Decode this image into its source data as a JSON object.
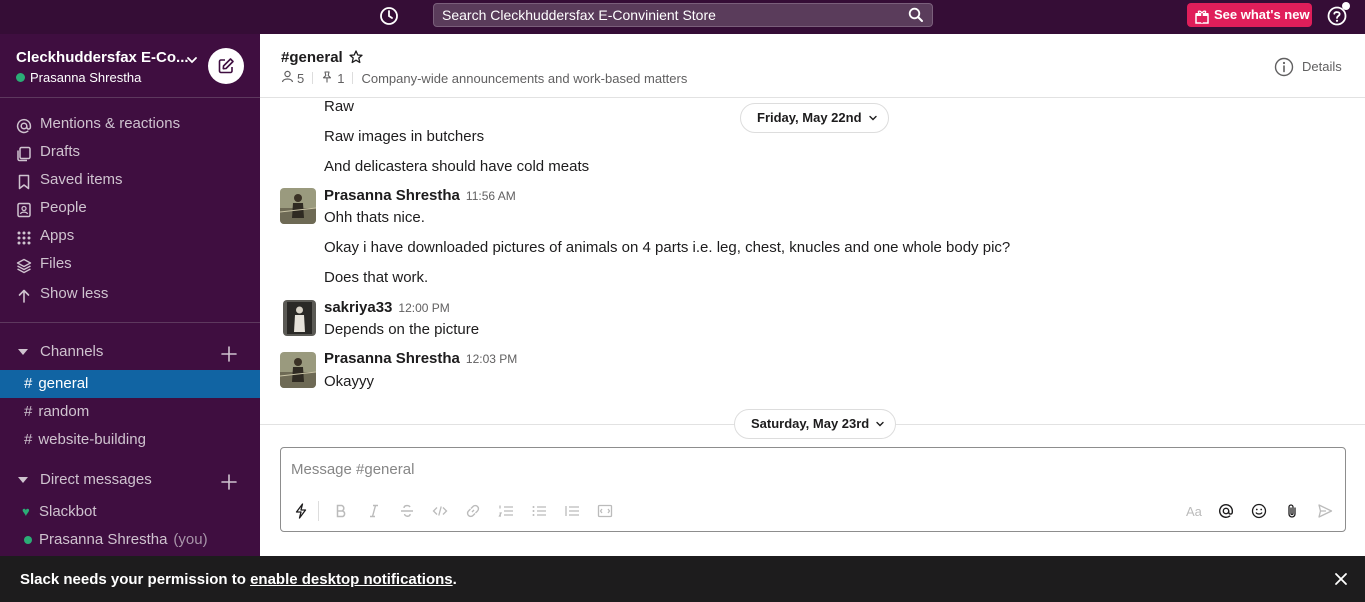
{
  "topbar": {
    "search_placeholder": "Search Cleckhuddersfax E-Convinient Store",
    "whats_new_label": "See what's new",
    "icons": [
      "history-icon",
      "search-icon",
      "gift-icon",
      "help-icon"
    ]
  },
  "workspace": {
    "name": "Cleckhuddersfax E-Co...",
    "user": "Prasanna Shrestha"
  },
  "nav": {
    "items": [
      {
        "label": "Mentions & reactions",
        "icon": "at-icon"
      },
      {
        "label": "Drafts",
        "icon": "drafts-icon"
      },
      {
        "label": "Saved items",
        "icon": "bookmark-icon"
      },
      {
        "label": "People",
        "icon": "people-icon"
      },
      {
        "label": "Apps",
        "icon": "apps-grid-icon"
      },
      {
        "label": "Files",
        "icon": "layers-icon"
      },
      {
        "label": "Show less",
        "icon": "arrow-up-icon"
      }
    ]
  },
  "channels": {
    "heading": "Channels",
    "items": [
      {
        "name": "general",
        "active": true
      },
      {
        "name": "random",
        "active": false
      },
      {
        "name": "website-building",
        "active": false
      }
    ]
  },
  "direct_messages": {
    "heading": "Direct messages",
    "items": [
      {
        "name": "Slackbot",
        "suffix": ""
      },
      {
        "name": "Prasanna Shrestha",
        "suffix": "(you)"
      }
    ]
  },
  "channel_header": {
    "name": "#general",
    "member_count": "5",
    "pinned_count": "1",
    "topic": "Company-wide announcements and work-based matters",
    "details_label": "Details"
  },
  "messages": {
    "date_top": "Friday, May 22nd",
    "date_bottom": "Saturday, May 23rd",
    "continued": [
      "Raw",
      "Raw images in butchers",
      "And delicastera should have cold meats"
    ],
    "groups": [
      {
        "author": "Prasanna Shrestha",
        "time": "11:56 AM",
        "lines": [
          "Ohh thats nice.",
          "Okay i have downloaded pictures of animals on 4 parts i.e. leg, chest, knucles and one whole body pic?",
          "Does that work."
        ]
      },
      {
        "author": "sakriya33",
        "time": "12:00 PM",
        "lines": [
          "Depends on the picture"
        ]
      },
      {
        "author": "Prasanna Shrestha",
        "time": "12:03 PM",
        "lines": [
          "Okayyy"
        ]
      }
    ]
  },
  "composer": {
    "placeholder": "Message #general"
  },
  "banner": {
    "text_before": "Slack needs your permission to ",
    "link_text": "enable desktop notifications",
    "text_after": "."
  },
  "colors": {
    "topbar": "#350d36",
    "sidebar": "#3f0e40",
    "active_channel": "#1164a3",
    "whats_new": "#e01e5a",
    "presence": "#2bac76"
  }
}
